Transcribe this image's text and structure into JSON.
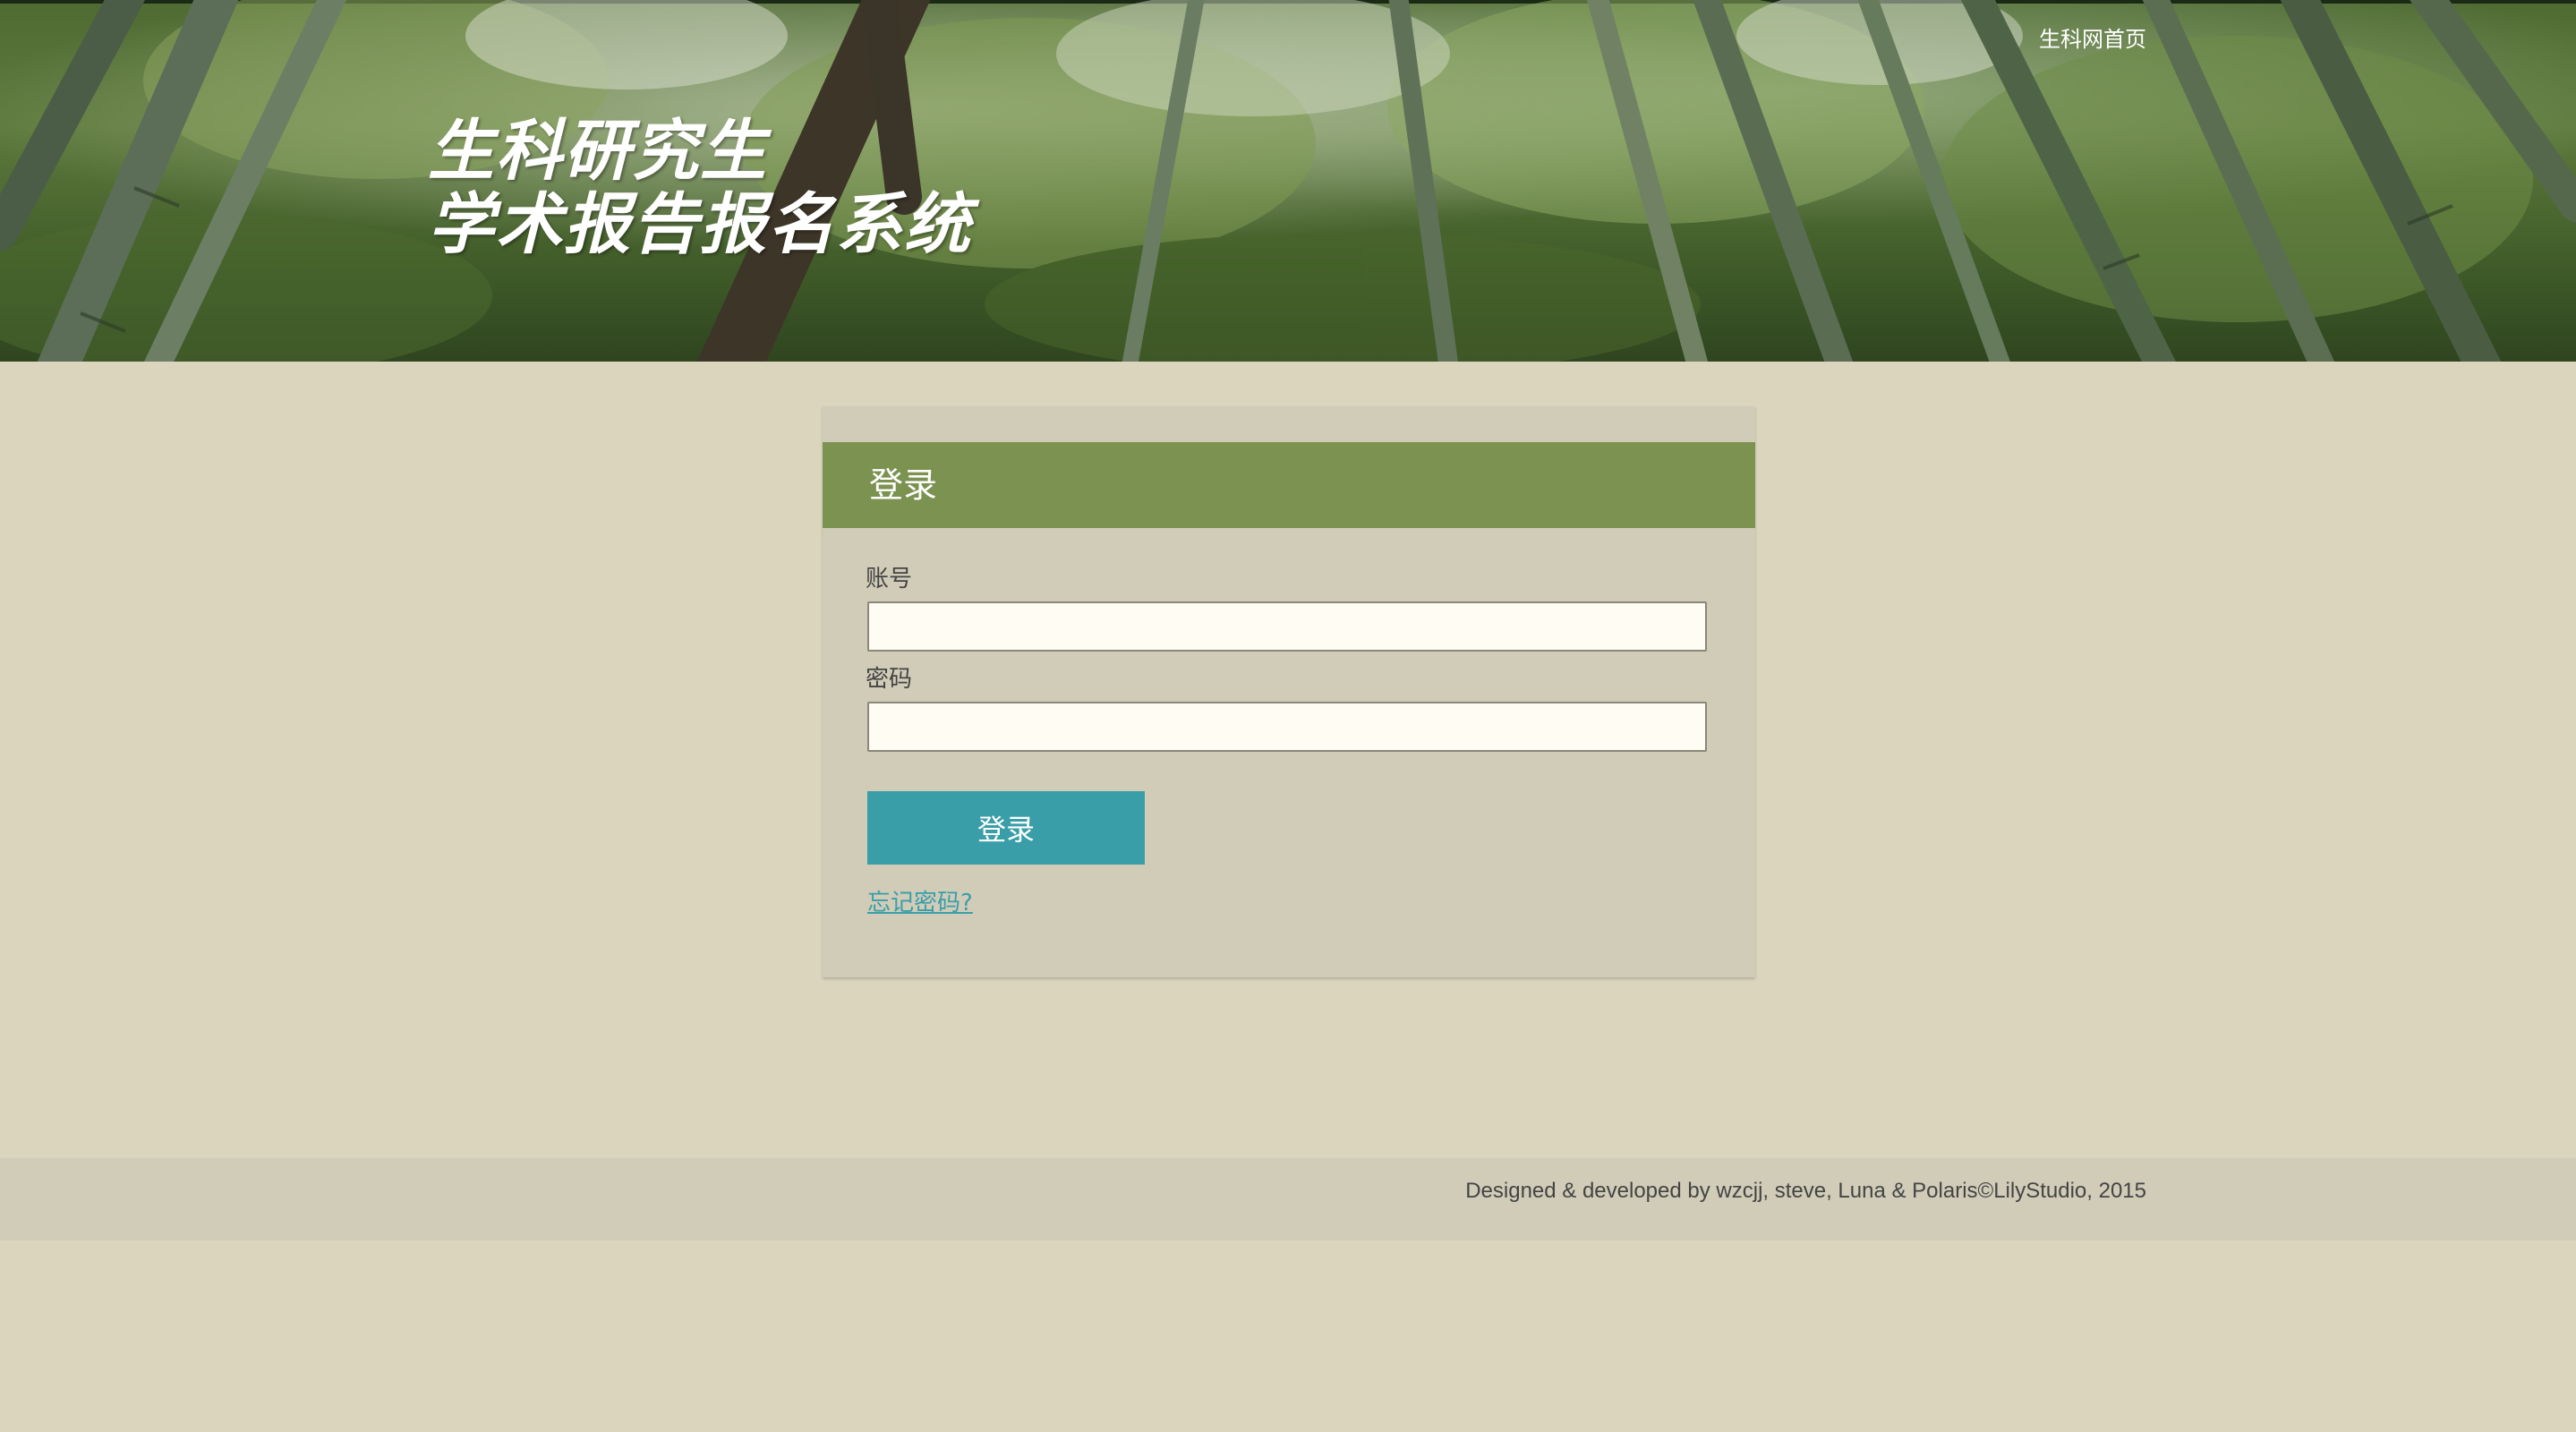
{
  "header": {
    "title_line1": "生科研究生",
    "title_line2": "学术报告报名系统",
    "home_link": "生科网首页"
  },
  "login": {
    "heading": "登录",
    "account_label": "账号",
    "account_value": "",
    "password_label": "密码",
    "password_value": "",
    "submit_label": "登录",
    "forgot_label": "忘记密码?"
  },
  "footer": {
    "credits": "Designed & developed by wzcjj, steve, Luna & Polaris©LilyStudio, 2015"
  },
  "colors": {
    "page_background": "#dcd5bd",
    "panel_background": "#d0ccb8",
    "panel_heading": "#7c9251",
    "button": "#3a9ea9",
    "link": "#3a9ea9",
    "input_background": "#fffcf3"
  }
}
